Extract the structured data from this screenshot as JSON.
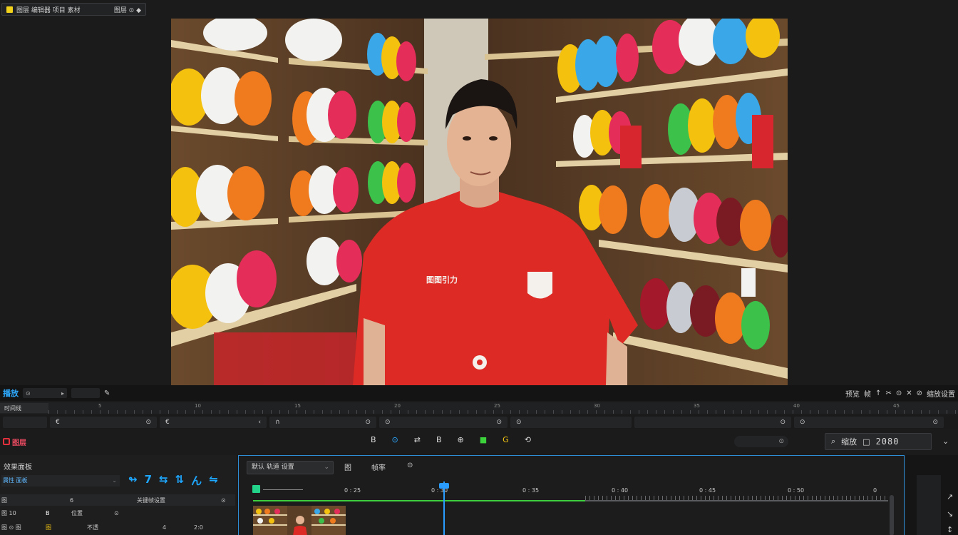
{
  "top_tab": {
    "label": "图层 编辑器 项目 素材",
    "right": "图层 ⊙ ◆"
  },
  "playback_bar": {
    "left_label": "播放",
    "left_field": "⊙",
    "right_items": [
      "预览",
      "帧",
      "↑",
      "✂",
      "⊙",
      "✕",
      "⊘",
      "缩放设置"
    ]
  },
  "ruler": {
    "label": "时间线",
    "marks": [
      "5",
      "10",
      "15",
      "20",
      "25",
      "30",
      "35",
      "40",
      "45"
    ]
  },
  "controls_row": {
    "cells": [
      {
        "left": "",
        "right": ""
      },
      {
        "left": "€",
        "right": "⊙"
      },
      {
        "left": "€",
        "right": "‹"
      },
      {
        "left": "∩",
        "right": "⊙"
      },
      {
        "left": "⊙",
        "right": "⊙"
      },
      {
        "left": "⊙",
        "right": ""
      },
      {
        "left": "",
        "right": "⊙"
      },
      {
        "left": "⊙",
        "right": "⊙"
      }
    ]
  },
  "toolbar": {
    "record_label": "图层",
    "tools": [
      "B",
      "⊙",
      "⇄",
      "B",
      "⊕",
      "■",
      "G",
      "⟲"
    ],
    "search_pill": "⊙",
    "zoom_label_a": "缩放",
    "zoom_value": "2080",
    "end_icon": "⌄"
  },
  "left_panel": {
    "title": "效果面板",
    "dropdown": "属性 面板",
    "blue_icons": [
      "↬",
      "7",
      "⇆",
      "⇅",
      "ん",
      "⇋"
    ],
    "row_a": {
      "c1": "图",
      "c2": "6",
      "c3": "关键帧设置",
      "c4": "⊙"
    },
    "row_b": {
      "c1": "图 10",
      "c2": "B",
      "c3": "位置",
      "c4": "⊙"
    },
    "row_c": {
      "c1": "图 ⊙ 图",
      "c2": "图",
      "c3": "不透",
      "c4": "4",
      "c5": "2:0"
    }
  },
  "timeline": {
    "dropdown": "默认 轨道 设置",
    "tabs": [
      "图",
      "帧率",
      "⊙"
    ],
    "ticks": [
      "0 : 25",
      "0 : 30",
      "0 : 35",
      "0 : 40",
      "0 : 45",
      "0 : 50",
      "0"
    ]
  },
  "right_panel": {
    "icons": [
      "↗",
      "↘",
      "↕"
    ]
  }
}
